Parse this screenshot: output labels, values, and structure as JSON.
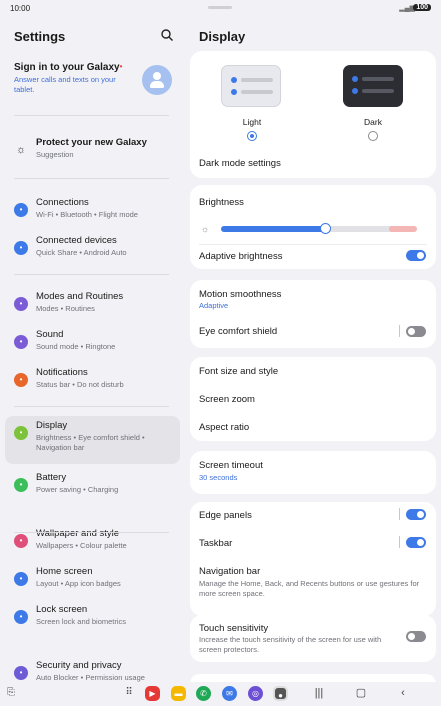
{
  "status": {
    "time": "10:00",
    "battery": "100"
  },
  "left": {
    "title": "Settings",
    "signin": {
      "title": "Sign in to your Galaxy",
      "subtitle": "Answer calls and texts on your tablet."
    },
    "protect": {
      "title": "Protect your new Galaxy",
      "subtitle": "Suggestion"
    },
    "items": [
      {
        "label": "Connections",
        "sub": "Wi-Fi  •  Bluetooth  •  Flight mode",
        "color": "#3e79e8",
        "icon": "wifi-icon"
      },
      {
        "label": "Connected devices",
        "sub": "Quick Share  •  Android Auto",
        "color": "#3e79e8",
        "icon": "connected-devices-icon"
      },
      {
        "label": "Modes and Routines",
        "sub": "Modes  •  Routines",
        "color": "#7b5cd6",
        "icon": "modes-icon"
      },
      {
        "label": "Sound",
        "sub": "Sound mode  •  Ringtone",
        "color": "#7b5cd6",
        "icon": "sound-icon"
      },
      {
        "label": "Notifications",
        "sub": "Status bar  •  Do not disturb",
        "color": "#e8662c",
        "icon": "notifications-icon"
      },
      {
        "label": "Display",
        "sub": "Brightness  •  Eye comfort shield  •  Navigation bar",
        "color": "#7cc23a",
        "icon": "display-icon"
      },
      {
        "label": "Battery",
        "sub": "Power saving  •  Charging",
        "color": "#3cbf5a",
        "icon": "battery-icon"
      },
      {
        "label": "Wallpaper and style",
        "sub": "Wallpapers  •  Colour palette",
        "color": "#e04f7a",
        "icon": "wallpaper-icon"
      },
      {
        "label": "Home screen",
        "sub": "Layout  •  App icon badges",
        "color": "#3e79e8",
        "icon": "home-icon"
      },
      {
        "label": "Lock screen",
        "sub": "Screen lock and biometrics",
        "color": "#3e79e8",
        "icon": "lock-icon"
      },
      {
        "label": "Security and privacy",
        "sub": "Auto Blocker  •  Permission usage",
        "color": "#6c5cd6",
        "icon": "security-icon"
      }
    ]
  },
  "right": {
    "title": "Display",
    "theme": {
      "light": "Light",
      "dark": "Dark",
      "selected": "light"
    },
    "dark_mode_settings": "Dark mode settings",
    "brightness": {
      "label": "Brightness",
      "level": 0.53
    },
    "adaptive_brightness": {
      "label": "Adaptive brightness",
      "on": true
    },
    "motion": {
      "label": "Motion smoothness",
      "value": "Adaptive"
    },
    "eye_comfort": {
      "label": "Eye comfort shield",
      "on": false
    },
    "font": "Font size and style",
    "zoom": "Screen zoom",
    "aspect": "Aspect ratio",
    "timeout": {
      "label": "Screen timeout",
      "value": "30 seconds"
    },
    "edge_panels": {
      "label": "Edge panels",
      "on": true
    },
    "taskbar": {
      "label": "Taskbar",
      "on": true
    },
    "navigation_bar": {
      "label": "Navigation bar",
      "sub": "Manage the Home, Back, and Recents buttons or use gestures for more screen space."
    },
    "touch": {
      "label": "Touch sensitivity",
      "sub": "Increase the touch sensitivity of the screen for use with screen protectors.",
      "on": false
    }
  },
  "colors": {
    "accent": "#3e79e8",
    "background": "#f2f2f6"
  }
}
